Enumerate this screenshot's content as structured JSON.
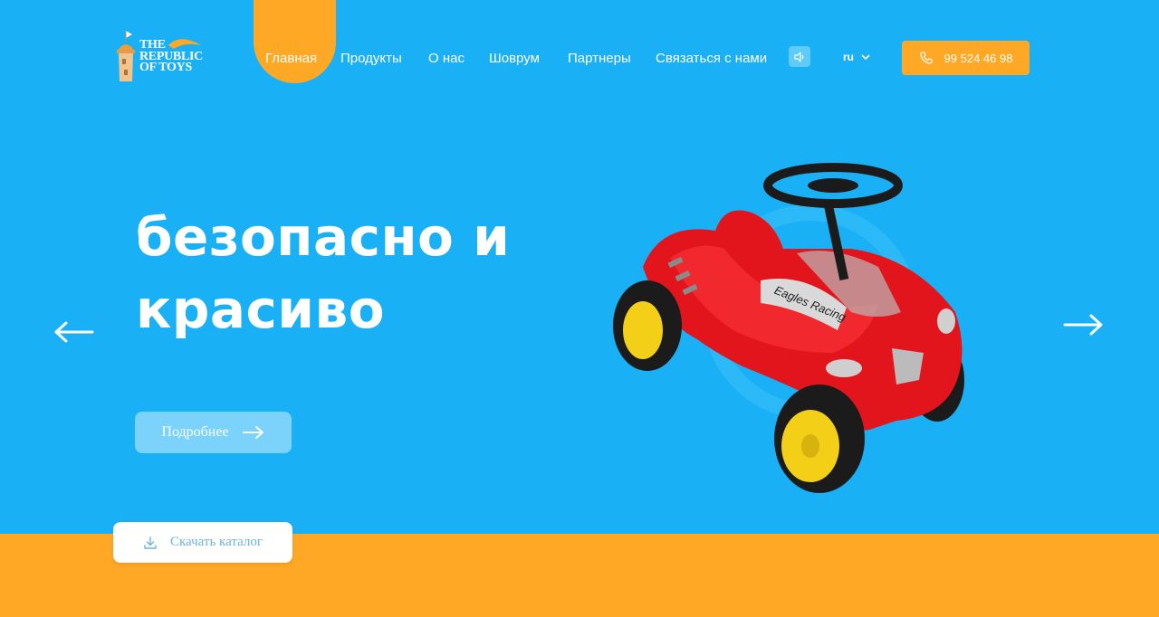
{
  "logo": {
    "lines": [
      "THE",
      "REPUBLIC",
      "OF TOYS"
    ]
  },
  "nav": {
    "items": [
      {
        "label": "Главная",
        "active": true
      },
      {
        "label": "Продукты"
      },
      {
        "label": "О нас"
      },
      {
        "label": "Шоврум"
      },
      {
        "label": "Партнеры"
      },
      {
        "label": "Связаться с нами"
      }
    ]
  },
  "header": {
    "sound_icon": "speaker-icon",
    "language": "ru",
    "phone": "99 524 46 98"
  },
  "hero": {
    "headline_line1": "безопасно и",
    "headline_line2": "красиво",
    "more_label": "Подробнее",
    "catalog_label": "Скачать каталог"
  },
  "colors": {
    "sky_blue": "#1ab0f5",
    "orange": "#ffa826",
    "button_blue": "#7bd2fb"
  }
}
